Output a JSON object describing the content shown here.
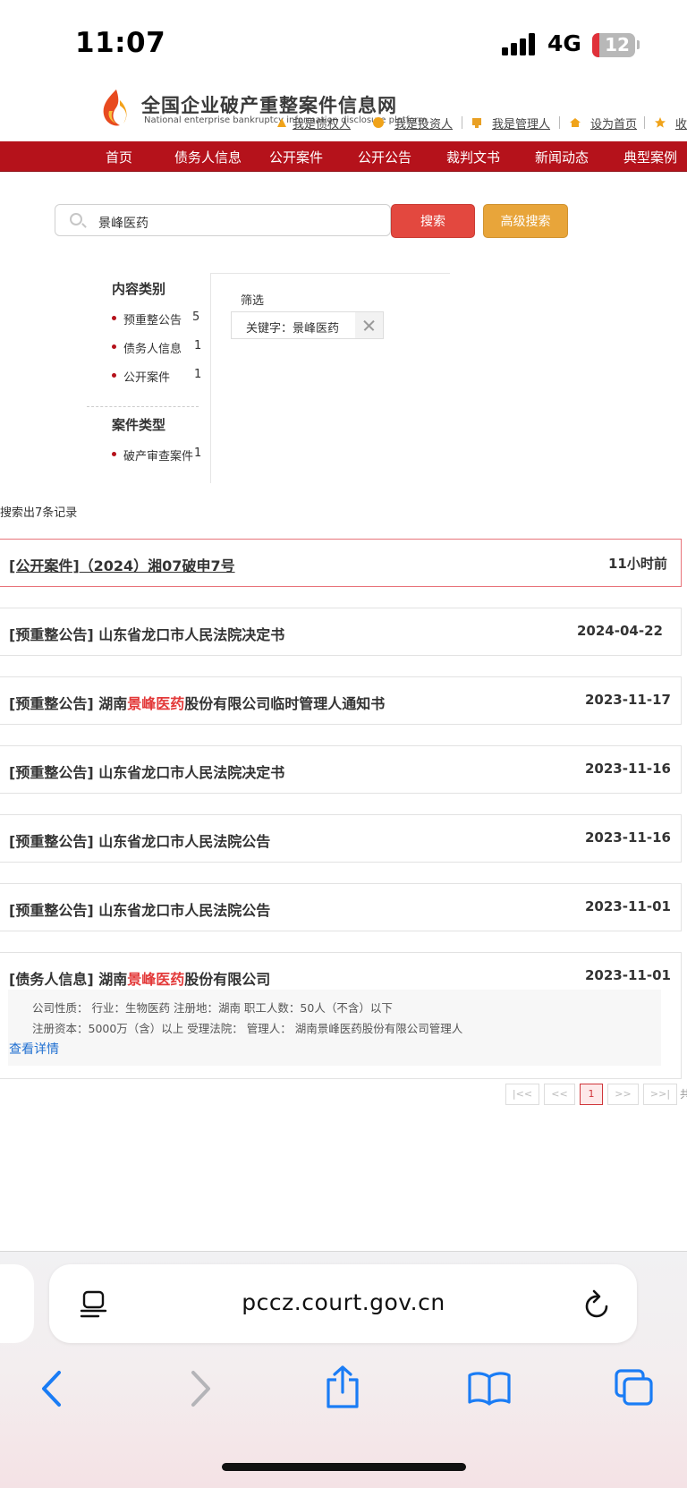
{
  "status_bar": {
    "time": "11:07",
    "network": "4G",
    "battery": "12"
  },
  "site": {
    "title": "全国企业破产重整案件信息网",
    "subtitle": "National enterprise bankruptcy information disclosure platform",
    "top_links": [
      "我是债权人",
      "我是投资人",
      "我是管理人",
      "设为首页",
      "收"
    ]
  },
  "nav": {
    "items": [
      "首页",
      "债务人信息",
      "公开案件",
      "公开公告",
      "裁判文书",
      "新闻动态",
      "典型案例"
    ]
  },
  "search": {
    "value": "景峰医药",
    "search_button": "搜索",
    "advanced_button": "高级搜索"
  },
  "sidebar": {
    "content_heading": "内容类别",
    "content_items": [
      {
        "label": "预重整公告",
        "count": "5"
      },
      {
        "label": "债务人信息",
        "count": "1"
      },
      {
        "label": "公开案件",
        "count": "1"
      }
    ],
    "case_heading": "案件类型",
    "case_items": [
      {
        "label": "破产审查案件",
        "count": "1"
      }
    ]
  },
  "filter": {
    "label": "筛选",
    "chip": "关键字：景峰医药"
  },
  "results": {
    "count_text": "搜索出7条记录",
    "items": [
      {
        "tag": "[公开案件]",
        "title": "（2024）湘07破申7号",
        "date": "11小时前"
      },
      {
        "tag": "[预重整公告]",
        "title": "山东省龙口市人民法院决定书",
        "date": "2024-04-22"
      },
      {
        "tag": "[预重整公告]",
        "title_pre": "湖南",
        "title_hl": "景峰医药",
        "title_post": "股份有限公司临时管理人通知书",
        "date": "2023-11-17"
      },
      {
        "tag": "[预重整公告]",
        "title": "山东省龙口市人民法院决定书",
        "date": "2023-11-16"
      },
      {
        "tag": "[预重整公告]",
        "title": "山东省龙口市人民法院公告",
        "date": "2023-11-16"
      },
      {
        "tag": "[预重整公告]",
        "title": "山东省龙口市人民法院公告",
        "date": "2023-11-01"
      },
      {
        "tag": "[债务人信息]",
        "title_pre": "湖南",
        "title_hl": "景峰医药",
        "title_post": "股份有限公司",
        "date": "2023-11-01"
      }
    ],
    "detail_line1": "公司性质：  行业：生物医药  注册地：湖南  职工人数：50人（不含）以下",
    "detail_line2": "注册资本：5000万（含）以上  受理法院：  管理人：  湖南景峰医药股份有限公司管理人",
    "view_detail": "查看详情"
  },
  "pagination": {
    "first": "|<<",
    "prev": "<<",
    "current": "1",
    "next": ">>",
    "last": ">>|",
    "tail": "共"
  },
  "browser": {
    "url": "pccz.court.gov.cn"
  },
  "colors": {
    "brand_red": "#b5121b",
    "search_button": "#e3483f",
    "advanced_button": "#e8a53a",
    "highlight": "#e33a3a",
    "link_blue": "#1f6fd1",
    "ios_blue": "#1a7cf5"
  }
}
